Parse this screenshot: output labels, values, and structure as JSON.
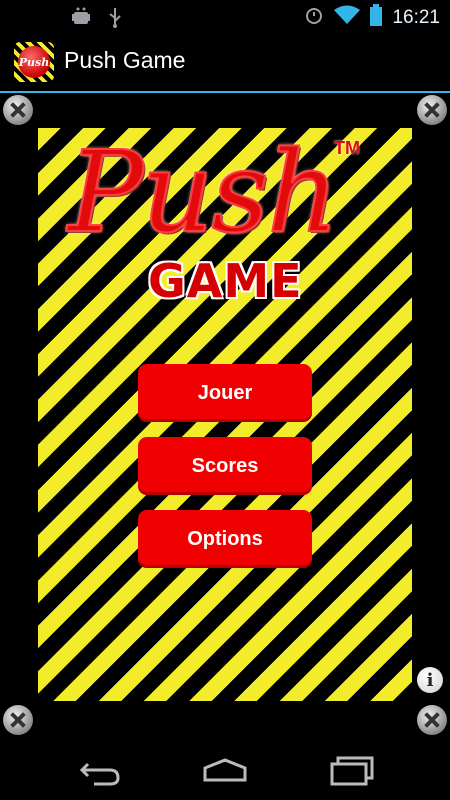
{
  "status_bar": {
    "time": "16:21",
    "icons": [
      "android-debug-icon",
      "usb-icon",
      "alarm-icon",
      "wifi-icon",
      "battery-icon"
    ]
  },
  "action_bar": {
    "title": "Push Game",
    "app_icon": "push-game-logo-icon"
  },
  "logo": {
    "word1": "Push",
    "trademark": "TM",
    "word2": "GAME"
  },
  "menu": {
    "buttons": [
      {
        "label": "Jouer"
      },
      {
        "label": "Scores"
      },
      {
        "label": "Options"
      }
    ]
  },
  "info_button": {
    "label": "i"
  },
  "nav_bar": {
    "icons": [
      "back-icon",
      "home-icon",
      "recent-apps-icon"
    ]
  },
  "colors": {
    "hazard_yellow": "#f2ec2a",
    "hazard_black": "#000000",
    "button_red": "#f00000",
    "accent_blue": "#33b5e5"
  }
}
